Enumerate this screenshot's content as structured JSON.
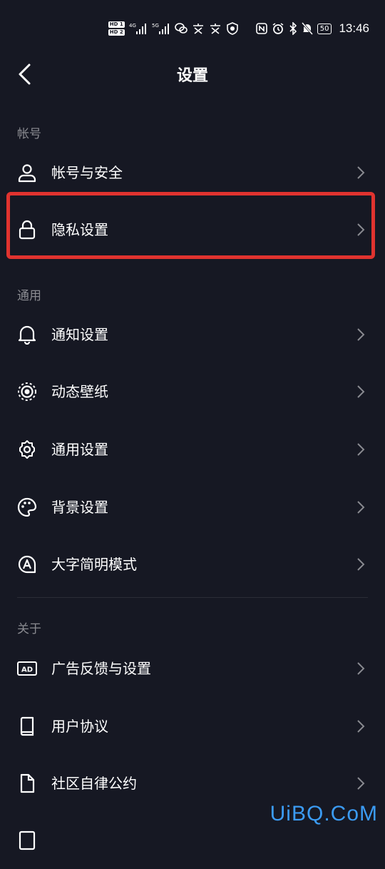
{
  "status_bar": {
    "hd1": "HD 1",
    "hd2": "HD 2",
    "net1": "4G",
    "net2": "5G",
    "battery": "50",
    "time": "13:46"
  },
  "header": {
    "title": "设置"
  },
  "sections": [
    {
      "label": "帐号",
      "items": [
        {
          "label": "帐号与安全",
          "icon": "user-icon"
        },
        {
          "label": "隐私设置",
          "icon": "lock-icon",
          "highlighted": true
        }
      ]
    },
    {
      "label": "通用",
      "items": [
        {
          "label": "通知设置",
          "icon": "bell-icon"
        },
        {
          "label": "动态壁纸",
          "icon": "live-wallpaper-icon"
        },
        {
          "label": "通用设置",
          "icon": "gear-icon"
        },
        {
          "label": "背景设置",
          "icon": "palette-icon"
        },
        {
          "label": "大字简明模式",
          "icon": "large-text-icon"
        }
      ]
    },
    {
      "label": "关于",
      "items": [
        {
          "label": "广告反馈与设置",
          "icon": "ad-icon"
        },
        {
          "label": "用户协议",
          "icon": "book-icon"
        },
        {
          "label": "社区自律公约",
          "icon": "document-icon"
        }
      ]
    }
  ],
  "watermark": "UiBQ.CoM",
  "colors": {
    "background": "#161823",
    "highlight": "#e0332f",
    "muted": "#8a8b91",
    "watermark": "#3b9bf3"
  }
}
